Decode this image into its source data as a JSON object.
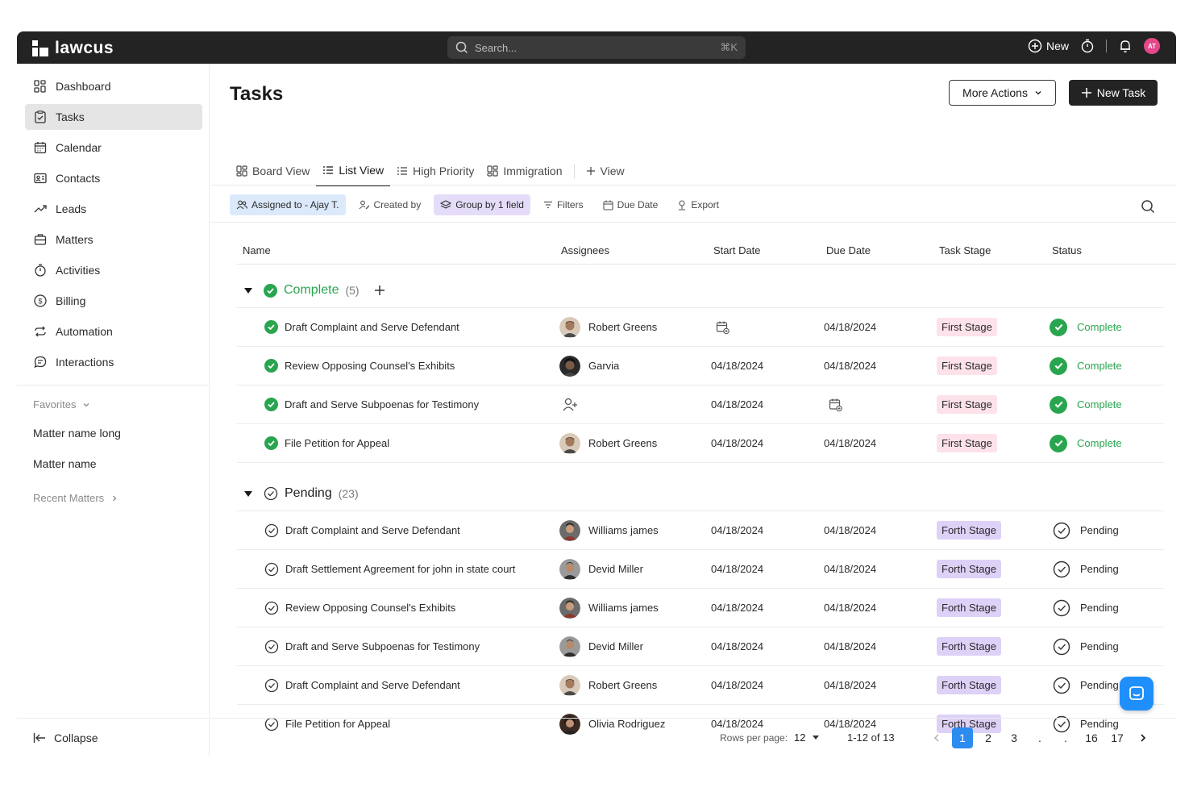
{
  "topbar": {
    "brand": "lawcus",
    "search_placeholder": "Search...",
    "search_shortcut": "⌘K",
    "new_label": "New",
    "avatar_initials": "AT"
  },
  "sidebar": {
    "items": [
      {
        "label": "Dashboard",
        "icon": "dashboard-icon"
      },
      {
        "label": "Tasks",
        "icon": "tasks-icon",
        "active": true
      },
      {
        "label": "Calendar",
        "icon": "calendar-icon"
      },
      {
        "label": "Contacts",
        "icon": "contacts-icon"
      },
      {
        "label": "Leads",
        "icon": "trend-icon"
      },
      {
        "label": "Matters",
        "icon": "briefcase-icon"
      },
      {
        "label": "Activities",
        "icon": "stopwatch-icon"
      },
      {
        "label": "Billing",
        "icon": "dollar-icon"
      },
      {
        "label": "Automation",
        "icon": "repeat-icon"
      },
      {
        "label": "Interactions",
        "icon": "chat-icon"
      }
    ],
    "favorites_label": "Favorites",
    "favorites": [
      "Matter name long",
      "Matter name"
    ],
    "recent_label": "Recent Matters",
    "collapse_label": "Collapse"
  },
  "main": {
    "title": "Tasks",
    "more_actions": "More Actions",
    "new_task": "New Task",
    "tabs": [
      "Board View",
      "List View",
      "High Priority",
      "Immigration",
      "View"
    ],
    "filters": {
      "assigned": "Assigned to - Ajay T.",
      "created_by": "Created by",
      "group_by": "Group by 1 field",
      "filters": "Filters",
      "due_date": "Due Date",
      "export": "Export"
    },
    "columns": {
      "name": "Name",
      "assignees": "Assignees",
      "start": "Start Date",
      "due": "Due Date",
      "stage": "Task Stage",
      "status": "Status"
    },
    "groups": {
      "complete": {
        "label": "Complete",
        "count": "(5)"
      },
      "pending": {
        "label": "Pending",
        "count": "(23)"
      }
    },
    "complete_rows": [
      {
        "name": "Draft Complaint and Serve Defendant",
        "assignee": "Robert Greens",
        "start": "",
        "due": "04/18/2024",
        "stage": "First Stage",
        "status": "Complete"
      },
      {
        "name": "Review Opposing Counsel's Exhibits",
        "assignee": "Garvia",
        "start": "04/18/2024",
        "due": "04/18/2024",
        "stage": "First Stage",
        "status": "Complete"
      },
      {
        "name": "Draft and Serve Subpoenas for Testimony",
        "assignee": "",
        "start": "04/18/2024",
        "due": "",
        "stage": "First Stage",
        "status": "Complete"
      },
      {
        "name": "File Petition for Appeal",
        "assignee": "Robert Greens",
        "start": "04/18/2024",
        "due": "04/18/2024",
        "stage": "First Stage",
        "status": "Complete"
      }
    ],
    "pending_rows": [
      {
        "name": "Draft Complaint and Serve Defendant",
        "assignee": "Williams james",
        "start": "04/18/2024",
        "due": "04/18/2024",
        "stage": "Forth Stage",
        "status": "Pending"
      },
      {
        "name": "Draft Settlement Agreement for john in state court",
        "assignee": "Devid Miller",
        "start": "04/18/2024",
        "due": "04/18/2024",
        "stage": "Forth Stage",
        "status": "Pending"
      },
      {
        "name": "Review Opposing Counsel's Exhibits",
        "assignee": "Williams james",
        "start": "04/18/2024",
        "due": "04/18/2024",
        "stage": "Forth Stage",
        "status": "Pending"
      },
      {
        "name": "Draft and Serve Subpoenas for Testimony",
        "assignee": "Devid Miller",
        "start": "04/18/2024",
        "due": "04/18/2024",
        "stage": "Forth Stage",
        "status": "Pending"
      },
      {
        "name": "Draft Complaint and Serve Defendant",
        "assignee": "Robert Greens",
        "start": "04/18/2024",
        "due": "04/18/2024",
        "stage": "Forth Stage",
        "status": "Pending"
      },
      {
        "name": "File Petition for Appeal",
        "assignee": "Olivia Rodriguez",
        "start": "04/18/2024",
        "due": "04/18/2024",
        "stage": "Forth Stage",
        "status": "Pending"
      }
    ],
    "pagination": {
      "rows_per_page_label": "Rows per page:",
      "rows_per_page": "12",
      "range": "1-12 of 13",
      "pages": [
        "1",
        "2",
        "3",
        ".",
        ".",
        "16",
        "17"
      ],
      "current": "1"
    }
  },
  "colors": {
    "topbar": "#232323",
    "accent": "#2d8cf0",
    "complete": "#2aa54f",
    "first_stage": "#fde2ea",
    "forth_stage": "#ddd1f7"
  }
}
